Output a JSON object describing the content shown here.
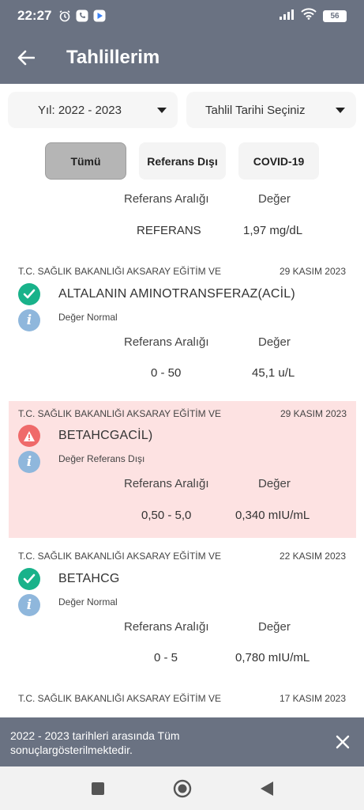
{
  "status_bar": {
    "time": "22:27",
    "battery": "56"
  },
  "app_bar": {
    "title": "Tahlillerim"
  },
  "filters": {
    "year": "Yıl: 2022 - 2023",
    "date": "Tahlil Tarihi Seçiniz"
  },
  "tabs": [
    {
      "label": "Tümü",
      "active": true
    },
    {
      "label": "Referans Dışı",
      "active": false
    },
    {
      "label": "COVID-19",
      "active": false
    }
  ],
  "columns": {
    "range": "Referans Aralığı",
    "value": "Değer"
  },
  "top_partial": {
    "range": "REFERANS",
    "value": "1,97 mg/dL"
  },
  "results": [
    {
      "institution": "T.C. SAĞLIK BAKANLIĞI AKSARAY EĞİTİM VE",
      "date": "29 KASIM 2023",
      "name": "ALTALANIN AMINOTRANSFERAZ(ACİL)",
      "status": "Değer Normal",
      "range": "0 - 50",
      "value": "45,1 u/L"
    },
    {
      "institution": "T.C. SAĞLIK BAKANLIĞI AKSARAY EĞİTİM VE",
      "date": "29 KASIM 2023",
      "name": "BETAHCGACİL)",
      "status": "Değer Referans Dışı",
      "range": "0,50 - 5,0",
      "value": "0,340 mIU/mL"
    },
    {
      "institution": "T.C. SAĞLIK BAKANLIĞI AKSARAY EĞİTİM VE",
      "date": "22 KASIM 2023",
      "name": "BETAHCG",
      "status": "Değer Normal",
      "range": "0 - 5",
      "value": "0,780 mIU/mL"
    },
    {
      "institution": "T.C. SAĞLIK BAKANLIĞI AKSARAY EĞİTİM VE",
      "date": "17 KASIM 2023"
    }
  ],
  "snackbar": {
    "line1": "2022 - 2023 tarihleri arasında Tüm",
    "line2": "sonuçlargösterilmektedir."
  },
  "colors": {
    "primary": "#6a7282",
    "ok": "#19b28a",
    "warn": "#ef6a6a",
    "info": "#8fb7dc",
    "out_of_range_bg": "#fde2e2"
  }
}
